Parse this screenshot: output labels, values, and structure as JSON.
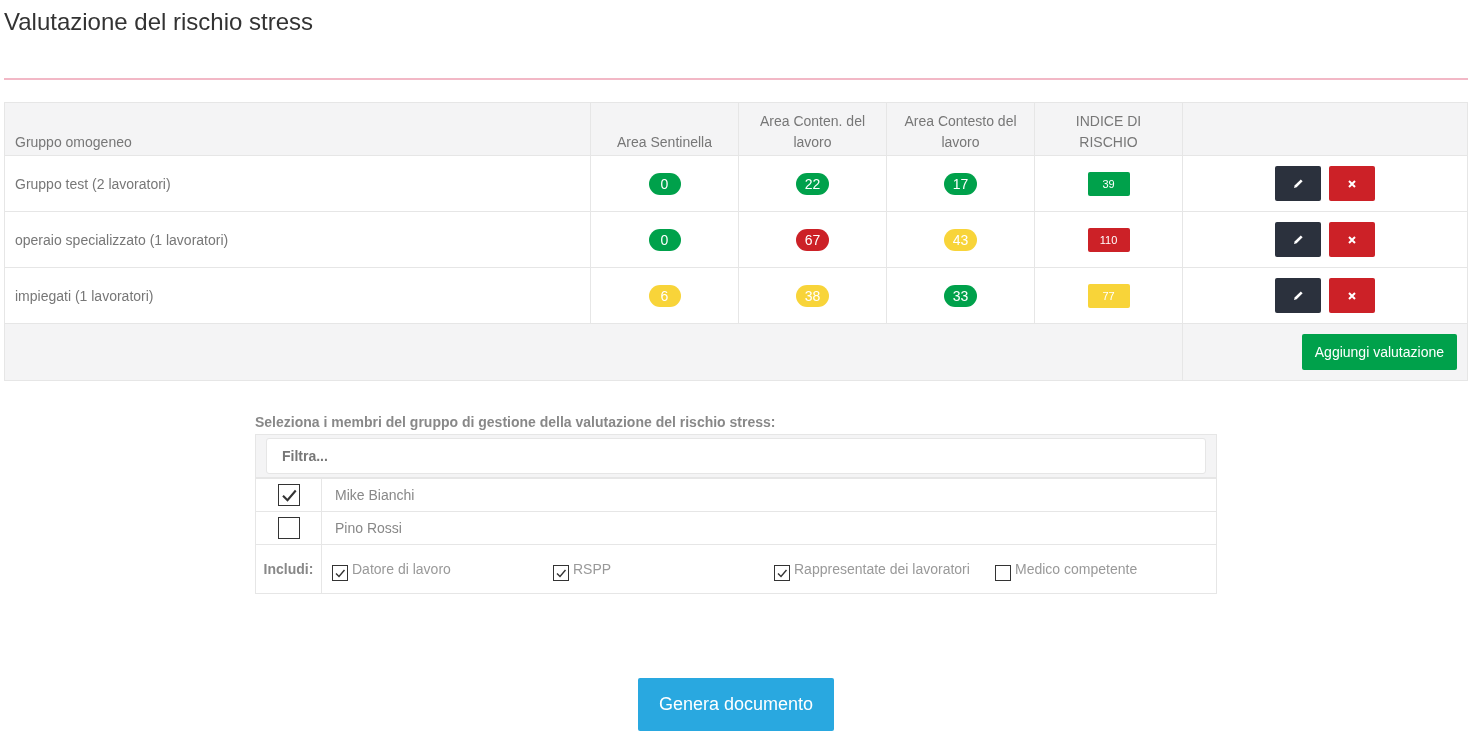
{
  "page": {
    "title": "Valutazione del rischio stress"
  },
  "table": {
    "columns": [
      "Gruppo omogeneo",
      "Area Sentinella",
      "Area Conten. del lavoro",
      "Area Contesto del lavoro",
      "INDICE DI RISCHIO"
    ],
    "rows": [
      {
        "group": "Gruppo test (2 lavoratori)",
        "scores": [
          {
            "value": "0",
            "color": "#00a14b"
          },
          {
            "value": "22",
            "color": "#00a14b"
          },
          {
            "value": "17",
            "color": "#00a14b"
          }
        ],
        "index": {
          "value": "39",
          "color": "#00a14b"
        }
      },
      {
        "group": "operaio specializzato (1 lavoratori)",
        "scores": [
          {
            "value": "0",
            "color": "#00a14b"
          },
          {
            "value": "67",
            "color": "#cc2127"
          },
          {
            "value": "43",
            "color": "#f8d439"
          }
        ],
        "index": {
          "value": "110",
          "color": "#cc2127"
        }
      },
      {
        "group": "impiegati (1 lavoratori)",
        "scores": [
          {
            "value": "6",
            "color": "#f8d439"
          },
          {
            "value": "38",
            "color": "#f8d439"
          },
          {
            "value": "33",
            "color": "#00a14b"
          }
        ],
        "index": {
          "value": "77",
          "color": "#f8d439"
        }
      }
    ],
    "add_button": "Aggiungi valutazione"
  },
  "members": {
    "label": "Seleziona i membri del gruppo di gestione della valutazione del rischio stress:",
    "filter": {
      "placeholder": "Filtra..."
    },
    "people": [
      {
        "name": "Mike Bianchi",
        "checked": true
      },
      {
        "name": "Pino Rossi",
        "checked": false
      }
    ],
    "include_label": "Includi:",
    "include": [
      {
        "label": "Datore di lavoro",
        "checked": true
      },
      {
        "label": "RSPP",
        "checked": true
      },
      {
        "label": "Rappresentate dei lavoratori",
        "checked": true
      },
      {
        "label": "Medico competente",
        "checked": false
      }
    ]
  },
  "generate_button": "Genera documento"
}
